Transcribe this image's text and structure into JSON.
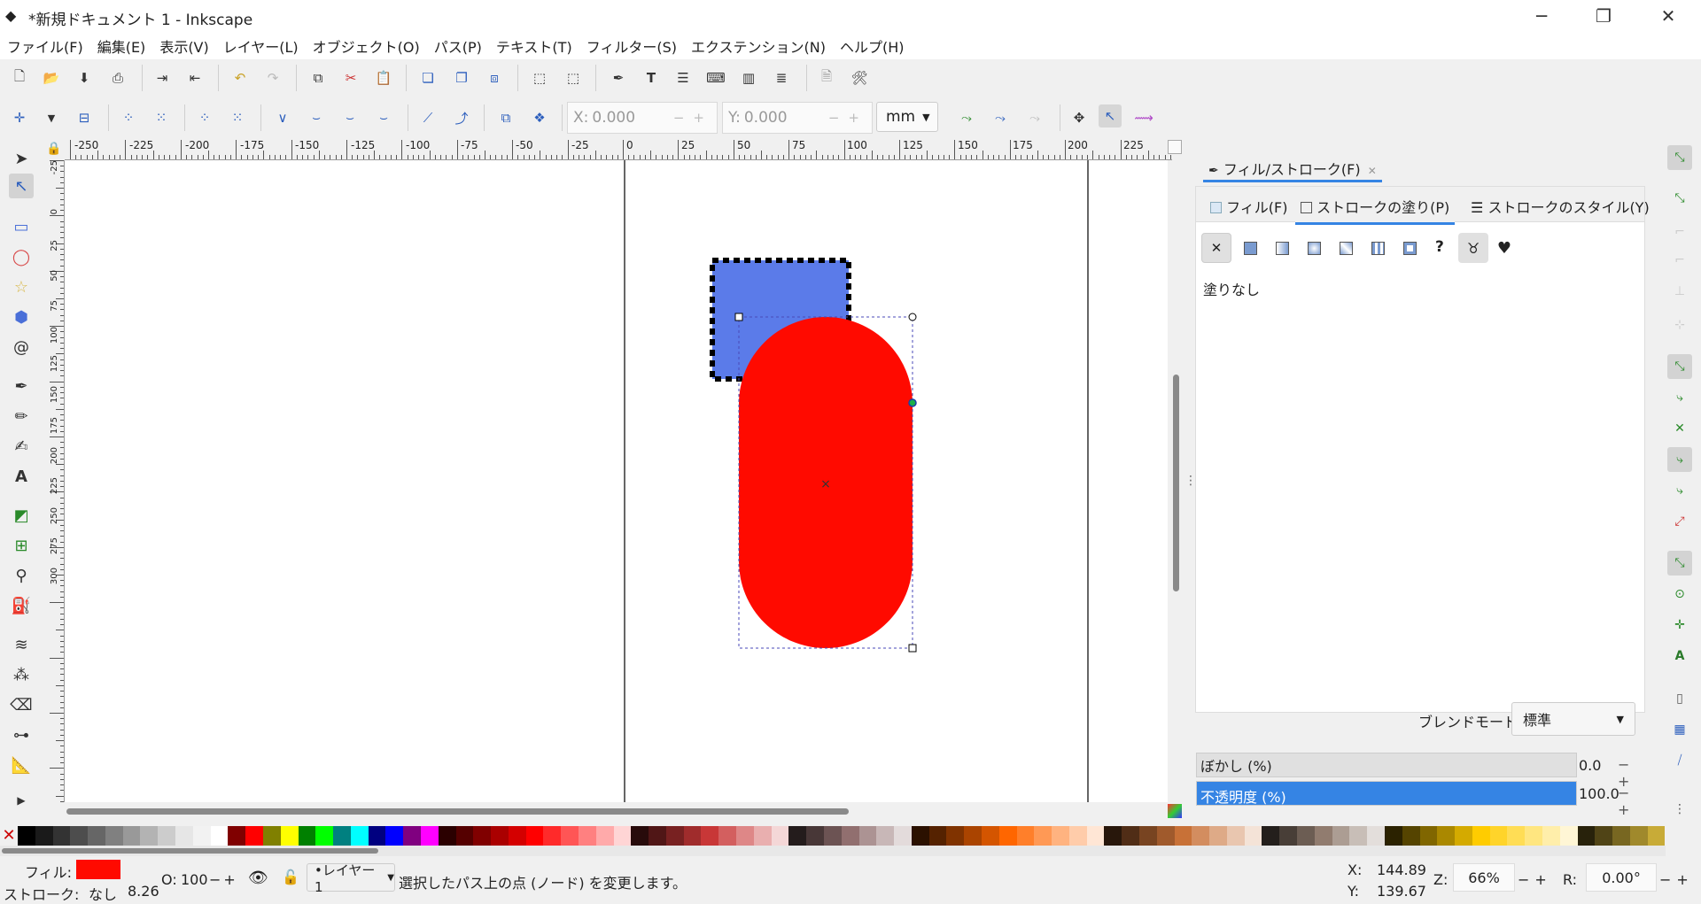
{
  "window": {
    "title": "*新規ドキュメント 1 - Inkscape",
    "minimize_icon": "─",
    "restore_icon": "❐",
    "close_icon": "✕"
  },
  "menu": [
    "ファイル(F)",
    "編集(E)",
    "表示(V)",
    "レイヤー(L)",
    "オブジェクト(O)",
    "パス(P)",
    "テキスト(T)",
    "フィルター(S)",
    "エクステンション(N)",
    "ヘルプ(H)"
  ],
  "toolbar": {
    "x_label": "X:",
    "x_value": "0.000",
    "y_label": "Y:",
    "y_value": "0.000",
    "unit": "mm",
    "minus": "−",
    "plus": "+"
  },
  "ruler_top": [
    "-250",
    "-225",
    "-200",
    "-175",
    "-150",
    "-125",
    "-100",
    "-75",
    "-50",
    "-25",
    "0",
    "25",
    "50",
    "75",
    "100",
    "125",
    "150",
    "175",
    "200",
    "225"
  ],
  "ruler_left": [
    "-25",
    "0",
    "25",
    "50",
    "75",
    "100",
    "125",
    "150",
    "175",
    "200",
    "225",
    "250",
    "275",
    "300"
  ],
  "panel": {
    "dialog_tab": "フィル/ストローク(F)",
    "dialog_close": "✕",
    "tab_fill": "フィル(F)",
    "tab_stroke_paint": "ストロークの塗り(P)",
    "tab_stroke_style": "ストロークのスタイル(Y)",
    "paint_none_label": "塗りなし",
    "unknown_paint_symbol": "?",
    "blend_label": "ブレンドモード:",
    "blend_value": "標準",
    "blur_label": "ぼかし (%)",
    "blur_value": "0.0",
    "opacity_label": "不透明度 (%)",
    "opacity_value": "100.0",
    "colors": {
      "accent": "#3584e4",
      "shape_blue": "#5b7be9",
      "shape_red": "#ff0a00"
    }
  },
  "palette": [
    "#000000",
    "#1a1a1a",
    "#333333",
    "#4d4d4d",
    "#666666",
    "#808080",
    "#999999",
    "#b3b3b3",
    "#cccccc",
    "#e6e6e6",
    "#f2f2f2",
    "#ffffff",
    "#800000",
    "#ff0000",
    "#808000",
    "#ffff00",
    "#008000",
    "#00ff00",
    "#008080",
    "#00ffff",
    "#000080",
    "#0000ff",
    "#800080",
    "#ff00ff",
    "#2b0000",
    "#550000",
    "#800000",
    "#aa0000",
    "#d40000",
    "#ff0000",
    "#ff2a2a",
    "#ff5555",
    "#ff8080",
    "#ffaaaa",
    "#ffd5d5",
    "#280b0b",
    "#501616",
    "#782121",
    "#a02c2c",
    "#c83737",
    "#d35f5f",
    "#de8787",
    "#e9afaf",
    "#f4d7d7",
    "#241c1c",
    "#483737",
    "#6c5353",
    "#916f6f",
    "#ac9393",
    "#c8b7b7",
    "#e3dbdb",
    "#2b1100",
    "#552200",
    "#803300",
    "#aa4400",
    "#d45500",
    "#ff6600",
    "#ff7f2a",
    "#ff9955",
    "#ffb380",
    "#ffccaa",
    "#ffe6d5",
    "#28170b",
    "#502d16",
    "#784421",
    "#a05a2c",
    "#c87137",
    "#d38d5f",
    "#deaa87",
    "#e9c6af",
    "#f4e3d7",
    "#241f1c",
    "#483e37",
    "#6c5d53",
    "#917c6f",
    "#ac9d93",
    "#c8beb7",
    "#e3dedb",
    "#2b2200",
    "#554400",
    "#806600",
    "#aa8800",
    "#d4aa00",
    "#ffcc00",
    "#ffd42a",
    "#ffdd55",
    "#ffe680",
    "#ffeeaa",
    "#fff6d5",
    "#28220b",
    "#504416",
    "#786721",
    "#a0892c",
    "#c8ab37"
  ],
  "status": {
    "fill_label": "フィル:",
    "stroke_label": "ストローク:",
    "stroke_value": "なし",
    "stroke_width": "8.26",
    "fill_color": "#ff0a00",
    "opacity_label": "O:",
    "opacity_value": "100",
    "layer": "•レイヤー 1",
    "message": "選択したパス上の点 (ノード) を変更します。",
    "x_label": "X:",
    "x_value": "144.89",
    "y_label": "Y:",
    "y_value": "139.67",
    "zoom_label": "Z:",
    "zoom_value": "66%",
    "rot_label": "R:",
    "rot_value": "0.00°"
  }
}
